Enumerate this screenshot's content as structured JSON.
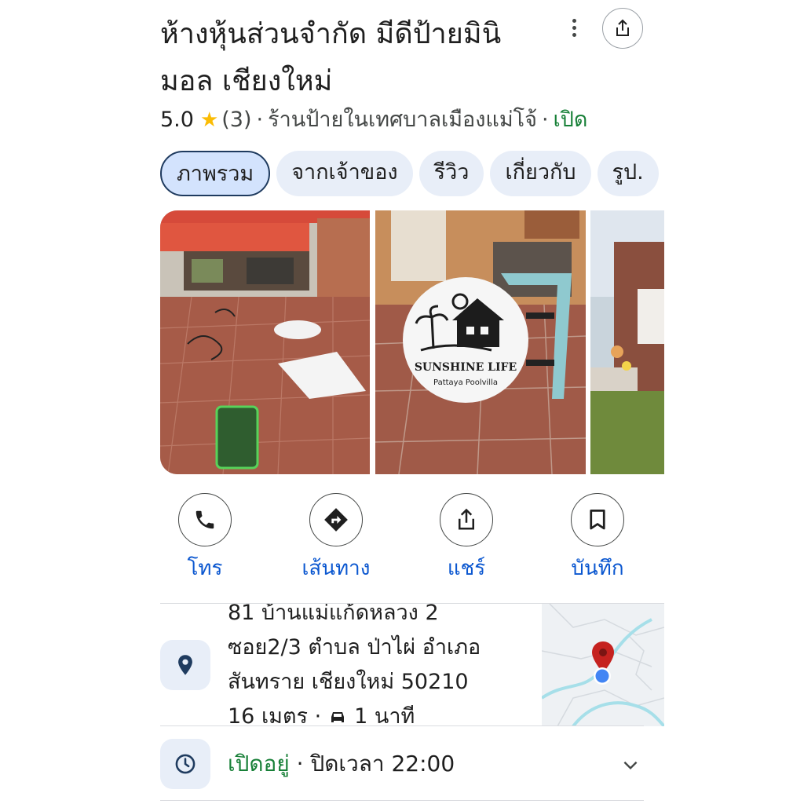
{
  "place": {
    "title": "ห้างหุ้นส่วนจำกัด มีดีป้ายมินิมอล เชียงใหม่",
    "rating": "5.0",
    "review_count": "(3)",
    "separator": "·",
    "category": "ร้านป้ายในเทศบาลเมืองแม่โจ้",
    "status": "เปิด"
  },
  "tabs": [
    {
      "label": "ภาพรวม"
    },
    {
      "label": "จากเจ้าของ"
    },
    {
      "label": "รีวิว"
    },
    {
      "label": "เกี่ยวกับ"
    },
    {
      "label": "รูป."
    }
  ],
  "photos": {
    "sign_text": "SUNSHINE LIFE",
    "sign_subtext": "Pattaya Poolvilla"
  },
  "actions": [
    {
      "label": "โทร",
      "icon": "phone-icon"
    },
    {
      "label": "เส้นทาง",
      "icon": "directions-icon"
    },
    {
      "label": "แชร์",
      "icon": "share-icon"
    },
    {
      "label": "บันทึก",
      "icon": "bookmark-icon"
    }
  ],
  "address": {
    "lines": [
      "81 บ้านแม่แก้ดหลวง 2",
      "ซอย2/3 ตำบล ป่าไผ่ อำเภอ",
      "สันทราย เชียงใหม่ 50210"
    ],
    "distance": "16 เมตร ·",
    "drive_time": "1 นาที"
  },
  "hours": {
    "status": "เปิดอยู่",
    "separator": " · ",
    "closes": "ปิดเวลา 22:00"
  },
  "colors": {
    "link_blue": "#0b57d0",
    "open_green": "#188038",
    "star": "#fbbc04",
    "chip_bg": "#e8eef8"
  }
}
